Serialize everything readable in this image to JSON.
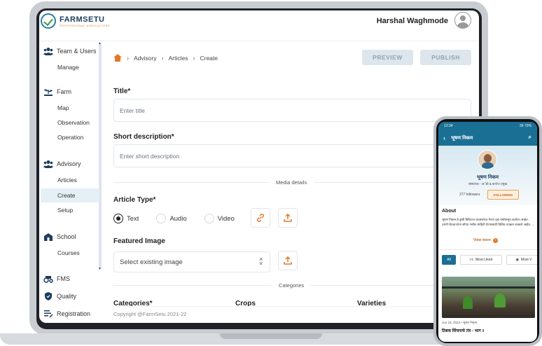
{
  "app": {
    "logo_name": "FARMSETU",
    "logo_tagline": "PROFESSIONAL AGRICULTURE",
    "user_name": "Harshal Waghmode"
  },
  "sidebar": {
    "sections": [
      {
        "label": "Team & Users",
        "icon": "users-icon",
        "items": [
          "Manage"
        ]
      },
      {
        "label": "Farm",
        "icon": "farm-icon",
        "items": [
          "Map",
          "Observation",
          "Operation"
        ]
      },
      {
        "label": "Advisory",
        "icon": "users-icon",
        "items": [
          "Articles",
          "Create",
          "Setup"
        ]
      },
      {
        "label": "School",
        "icon": "school-icon",
        "items": [
          "Courses"
        ]
      },
      {
        "label": "FMS",
        "icon": "fms-icon",
        "items": []
      },
      {
        "label": "Quality",
        "icon": "shield-icon",
        "items": []
      },
      {
        "label": "Registration",
        "icon": "registration-icon",
        "items": []
      }
    ],
    "active_item": "Create"
  },
  "breadcrumb": [
    "Advisory",
    "Articles",
    "Create"
  ],
  "actions": {
    "preview": "PREVIEW",
    "publish": "PUBLISH"
  },
  "form": {
    "title_label": "Title*",
    "title_placeholder": "Enter title",
    "short_desc_label": "Short description*",
    "short_desc_placeholder": "Enter short description",
    "media_divider": "Media details",
    "article_type_label": "Article Type*",
    "article_types": [
      "Text",
      "Audio",
      "Video"
    ],
    "article_type_selected": "Text",
    "featured_image_label": "Featured Image",
    "featured_image_select": "Select existing image",
    "categories_divider": "Categories",
    "categories_label": "Categories*",
    "crops_label": "Crops",
    "varieties_label": "Varieties"
  },
  "footer": {
    "copyright": "Copyright @FarmSetu 2021-22"
  },
  "phone": {
    "status_time": "12:34",
    "status_right": "26 72%",
    "title": "भूषण निकम",
    "profile_name": "भूषण निकम",
    "profile_role": "संस्थापक - अॅग्रो & कन्टेन्ट प्रमुख",
    "followers": "277 followers",
    "following_button": "FOLLOWING",
    "about_heading": "About",
    "about_text": "भूषण निकम हे कृषी डिजिटल व्यवसायात गेल्या दहा वर्षांपासून कार्यरत आहेत. त्यांनी शेतकऱ्यांना सोप्या भाषेत माहिती देण्यासाठी विविध उपक्रम राबवले आहेत. ...",
    "view_more": "View more",
    "chips": [
      "All",
      "Most Liked",
      "Most V"
    ],
    "post_meta": "Jun 23, 2023  •  भूषण निकम",
    "post_title": "ठिबक सिंचनाचे तंत्र - भाग २"
  },
  "colors": {
    "accent_orange": "#e07a2b",
    "brand_blue": "#1a6f95",
    "disabled_button_bg": "#dde6ec"
  }
}
